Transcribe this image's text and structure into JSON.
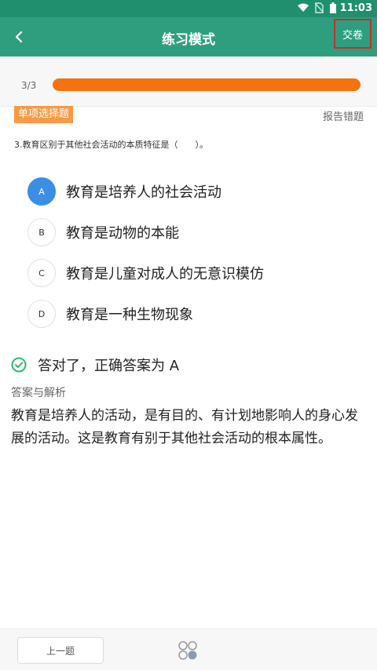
{
  "status_bar": {
    "time": "11:03"
  },
  "header": {
    "title": "练习模式",
    "submit_label": "交卷"
  },
  "progress": {
    "text": "3/3",
    "fraction": 1.0,
    "color": "#f5720f"
  },
  "question": {
    "type_badge": "单项选择题",
    "report_label": "报告错题",
    "text": "3.教育区别于其他社会活动的本质特征是（　　）。",
    "options": [
      {
        "letter": "A",
        "text": "教育是培养人的社会活动",
        "selected": true
      },
      {
        "letter": "B",
        "text": "教育是动物的本能",
        "selected": false
      },
      {
        "letter": "C",
        "text": "教育是儿童对成人的无意识模仿",
        "selected": false
      },
      {
        "letter": "D",
        "text": "教育是一种生物现象",
        "selected": false
      }
    ]
  },
  "result": {
    "text": "答对了，正确答案为 A",
    "icon": "check-circle-icon",
    "color": "#2bb673"
  },
  "analysis": {
    "label": "答案与解析",
    "text": "教育是培养人的活动，是有目的、有计划地影响人的身心发展的活动。这是教育有别于其他社会活动的根本属性。"
  },
  "bottom_bar": {
    "prev_label": "上一题",
    "grid_icon": "answer-sheet-icon"
  },
  "colors": {
    "header": "#2e9e7f",
    "status_bar": "#1f8f6e",
    "selected_option": "#3a8ee6",
    "badge": "#f79a43"
  }
}
